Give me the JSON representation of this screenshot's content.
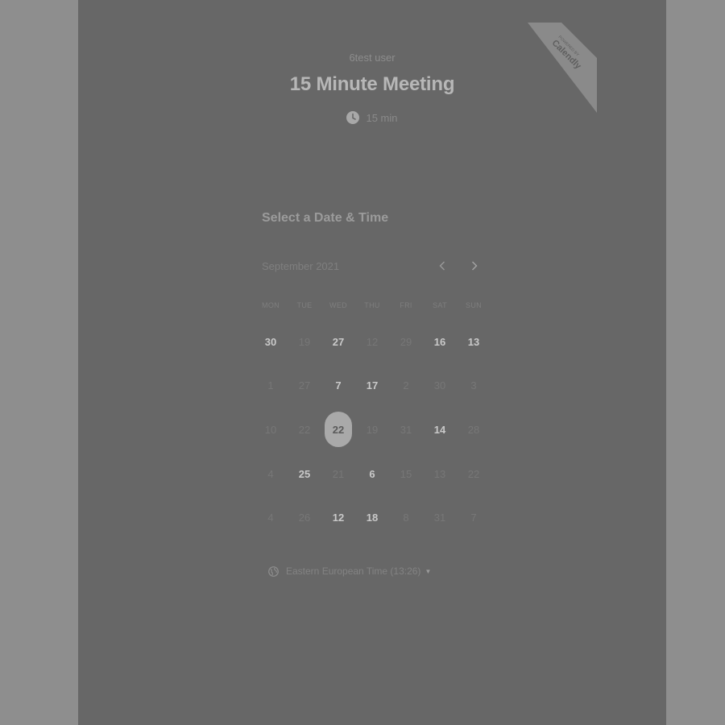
{
  "header": {
    "owner": "6test user",
    "title": "15 Minute Meeting",
    "duration": "15 min"
  },
  "badge": {
    "top_text": "POWERED BY",
    "brand": "Calendly"
  },
  "calendar": {
    "heading": "Select a Date & Time",
    "month": "September 2021",
    "weekdays": [
      "MON",
      "TUE",
      "WED",
      "THU",
      "FRI",
      "SAT",
      "SUN"
    ],
    "rows": [
      [
        {
          "d": "30",
          "a": true
        },
        {
          "d": "19",
          "a": false
        },
        {
          "d": "27",
          "a": true
        },
        {
          "d": "12",
          "a": false
        },
        {
          "d": "29",
          "a": false
        },
        {
          "d": "16",
          "a": true
        },
        {
          "d": "13",
          "a": true
        }
      ],
      [
        {
          "d": "1",
          "a": false
        },
        {
          "d": "27",
          "a": false
        },
        {
          "d": "7",
          "a": true
        },
        {
          "d": "17",
          "a": true
        },
        {
          "d": "2",
          "a": false
        },
        {
          "d": "30",
          "a": false
        },
        {
          "d": "3",
          "a": false
        }
      ],
      [
        {
          "d": "10",
          "a": false
        },
        {
          "d": "22",
          "a": false
        },
        {
          "d": "22",
          "a": true,
          "s": true
        },
        {
          "d": "19",
          "a": false
        },
        {
          "d": "31",
          "a": false
        },
        {
          "d": "14",
          "a": true
        },
        {
          "d": "28",
          "a": false
        }
      ],
      [
        {
          "d": "4",
          "a": false
        },
        {
          "d": "25",
          "a": true
        },
        {
          "d": "21",
          "a": false
        },
        {
          "d": "6",
          "a": true
        },
        {
          "d": "15",
          "a": false
        },
        {
          "d": "13",
          "a": false
        },
        {
          "d": "22",
          "a": false
        }
      ],
      [
        {
          "d": "4",
          "a": false
        },
        {
          "d": "26",
          "a": false
        },
        {
          "d": "12",
          "a": true
        },
        {
          "d": "18",
          "a": true
        },
        {
          "d": "8",
          "a": false
        },
        {
          "d": "31",
          "a": false
        },
        {
          "d": "7",
          "a": false
        }
      ]
    ]
  },
  "timezone": {
    "label": "Eastern European Time (13:26)"
  },
  "icons": {
    "clock": "clock-icon",
    "globe": "globe-icon",
    "prev": "chevron-left-icon",
    "next": "chevron-right-icon"
  }
}
